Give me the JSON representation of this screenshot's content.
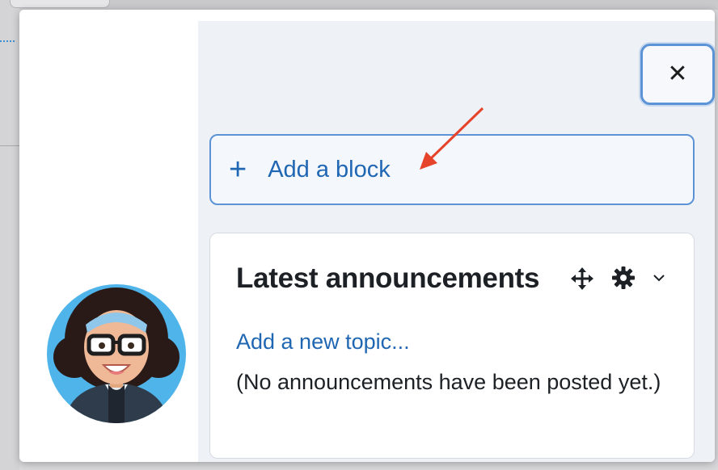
{
  "drawer": {
    "close_icon": "close-icon",
    "add_block": {
      "icon": "plus-icon",
      "label": "Add a block"
    },
    "announcements_block": {
      "title": "Latest announcements",
      "move_icon": "move-icon",
      "settings_icon": "gear-icon",
      "menu_icon": "chevron-down-icon",
      "add_topic_link": "Add a new topic...",
      "empty_message": "(No announcements have been posted yet.)"
    }
  },
  "annotation": {
    "arrow_color": "#e5432a"
  },
  "colors": {
    "link": "#1f66b3",
    "focus_border": "#5b93d6",
    "drawer_bg": "#eef1f6"
  }
}
